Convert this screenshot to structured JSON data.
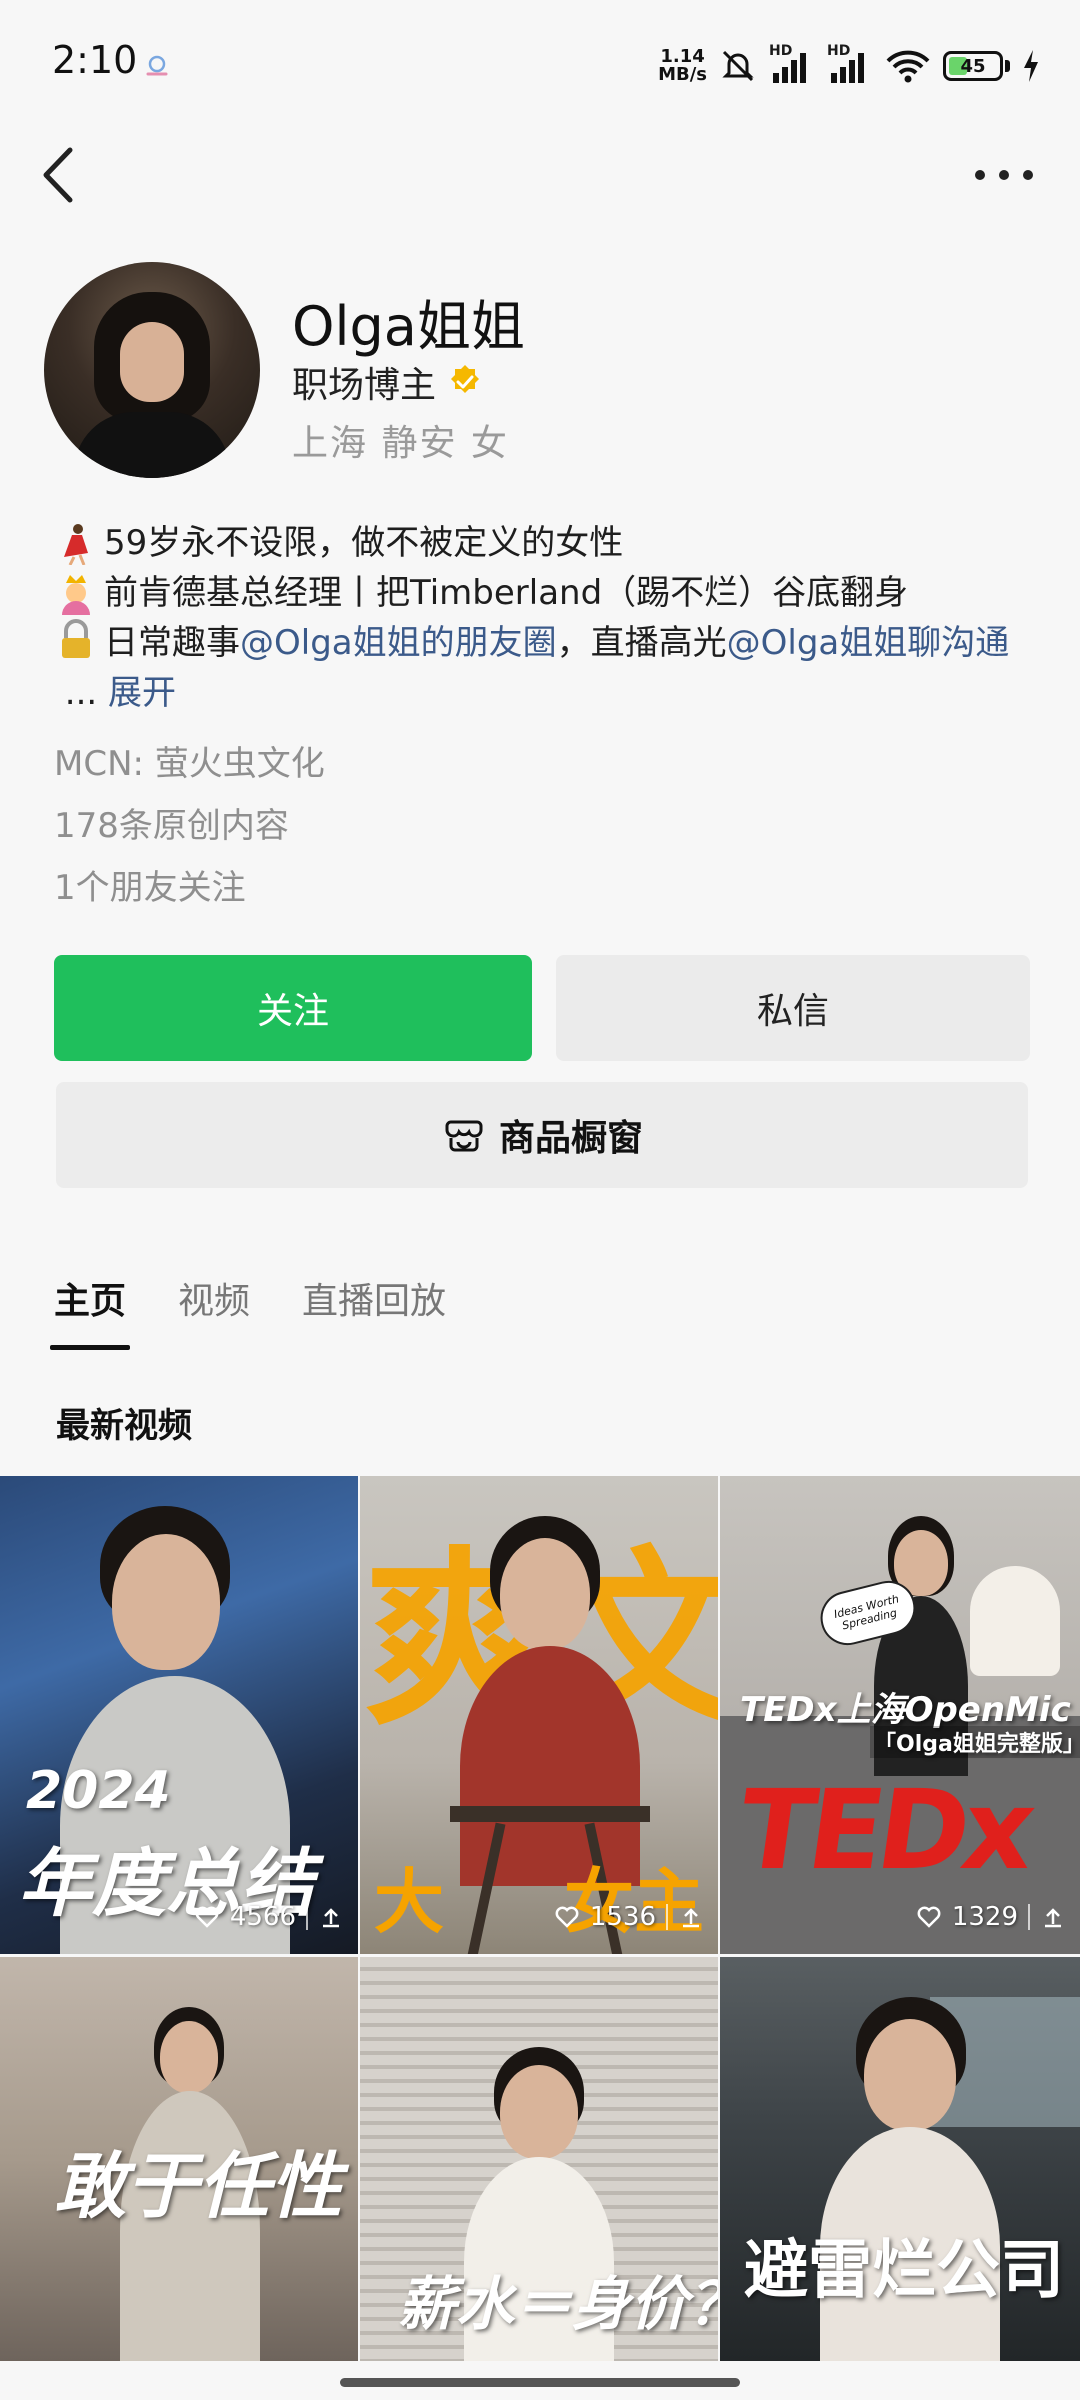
{
  "status_bar": {
    "time": "2:10",
    "net_speed_value": "1.14",
    "net_speed_unit": "MB/s",
    "signal1_label": "HD",
    "signal2_label": "HD",
    "battery_level": "45",
    "battery_fraction": 0.45
  },
  "profile": {
    "name": "Olga姐姐",
    "role": "职场博主",
    "location": "上海 静安 女",
    "bio": {
      "line1": "59岁永不设限，做不被定义的女性",
      "line2": "前肯德基总经理丨把Timberland（踢不烂）谷底翻身",
      "line3_prefix": "日常趣事",
      "line3_link1": "@Olga姐姐的朋友圈",
      "line3_mid": "，直播高光",
      "line3_link2": "@Olga姐姐聊沟通",
      "line3_ellipsis": " ... ",
      "expand": "展开"
    },
    "mcn": "MCN: 萤火虫文化",
    "original_count": "178条原创内容",
    "friends_following": "1个朋友关注"
  },
  "actions": {
    "follow": "关注",
    "message": "私信",
    "shop": "商品橱窗"
  },
  "tabs": [
    "主页",
    "视频",
    "直播回放"
  ],
  "section_title": "最新视频",
  "videos": [
    {
      "overlay_year": "2024",
      "overlay_title": "年度总结",
      "likes": "4566"
    },
    {
      "overlay_big": "爽文",
      "overlay_bottom_left": "大",
      "overlay_bottom_right": "女主",
      "likes": "1536"
    },
    {
      "overlay_title": "TEDx上海OpenMic",
      "overlay_sub": "「Olga姐姐完整版」",
      "sign_text": "Ideas Worth Spreading",
      "likes": "1329"
    },
    {
      "overlay_title": "敢于任性"
    },
    {
      "overlay_title": "薪水＝身价？"
    },
    {
      "overlay_title": "避雷烂公司"
    }
  ],
  "colors": {
    "follow_green": "#1fbf5c",
    "link_blue": "#3b5a8a",
    "verified_gold": "#f5b800"
  }
}
